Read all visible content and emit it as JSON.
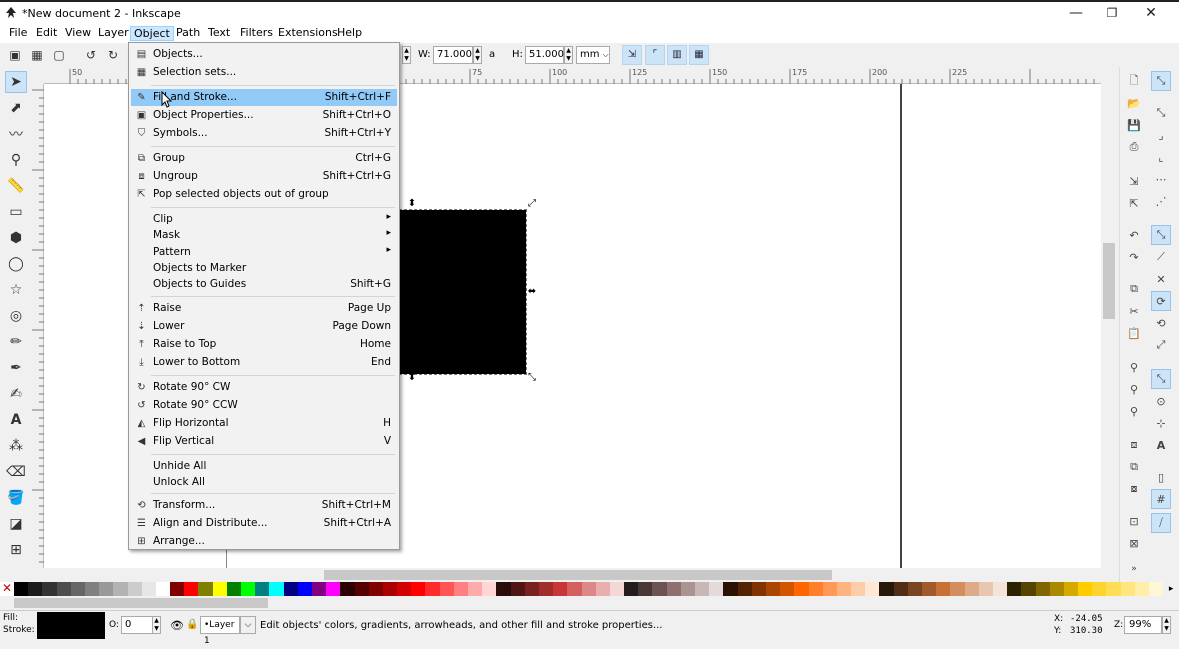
{
  "window": {
    "title": "*New document 2 - Inkscape",
    "minimize": "—",
    "maximize": "❐",
    "close": "✕"
  },
  "menubar": [
    "File",
    "Edit",
    "View",
    "Layer",
    "Object",
    "Path",
    "Text",
    "Filters",
    "Extensions",
    "Help"
  ],
  "toolbar": {
    "w_label": "W:",
    "w_value": "71.000",
    "h_label": "H:",
    "h_value": "51.000",
    "unit": "mm",
    "lock_symbol": "a"
  },
  "ruler": {
    "h_ticks": [
      "50",
      "75",
      "100",
      "125",
      "150",
      "175",
      "200",
      "225"
    ],
    "v_ticks": [
      "0",
      "25",
      "50",
      "75",
      "100",
      "125",
      "150"
    ]
  },
  "object_menu": {
    "groups": [
      [
        {
          "icon": "objects-icon",
          "glyph": "▤",
          "label": "Objects...",
          "shortcut": ""
        },
        {
          "icon": "selection-sets-icon",
          "glyph": "▦",
          "label": "Selection sets...",
          "shortcut": ""
        }
      ],
      [
        {
          "icon": "fill-stroke-icon",
          "glyph": "✎",
          "label": "Fill and Stroke...",
          "shortcut": "Shift+Ctrl+F",
          "highlight": true
        },
        {
          "icon": "object-properties-icon",
          "glyph": "▣",
          "label": "Object Properties...",
          "shortcut": "Shift+Ctrl+O"
        },
        {
          "icon": "symbols-icon",
          "glyph": "⛉",
          "label": "Symbols...",
          "shortcut": "Shift+Ctrl+Y"
        }
      ],
      [
        {
          "icon": "group-icon",
          "glyph": "⧉",
          "label": "Group",
          "shortcut": "Ctrl+G"
        },
        {
          "icon": "ungroup-icon",
          "glyph": "⧈",
          "label": "Ungroup",
          "shortcut": "Shift+Ctrl+G"
        },
        {
          "icon": "pop-out-icon",
          "glyph": "⇱",
          "label": "Pop selected objects out of group",
          "shortcut": ""
        }
      ],
      [
        {
          "icon": "",
          "glyph": "",
          "label": "Clip",
          "shortcut": "",
          "submenu": true
        },
        {
          "icon": "",
          "glyph": "",
          "label": "Mask",
          "shortcut": "",
          "submenu": true
        },
        {
          "icon": "",
          "glyph": "",
          "label": "Pattern",
          "shortcut": "",
          "submenu": true
        },
        {
          "icon": "",
          "glyph": "",
          "label": "Objects to Marker",
          "shortcut": ""
        },
        {
          "icon": "",
          "glyph": "",
          "label": "Objects to Guides",
          "shortcut": "Shift+G"
        }
      ],
      [
        {
          "icon": "raise-icon",
          "glyph": "⇡",
          "label": "Raise",
          "shortcut": "Page Up"
        },
        {
          "icon": "lower-icon",
          "glyph": "⇣",
          "label": "Lower",
          "shortcut": "Page Down"
        },
        {
          "icon": "raise-to-top-icon",
          "glyph": "⤒",
          "label": "Raise to Top",
          "shortcut": "Home"
        },
        {
          "icon": "lower-to-bottom-icon",
          "glyph": "⤓",
          "label": "Lower to Bottom",
          "shortcut": "End"
        }
      ],
      [
        {
          "icon": "rotate-cw-icon",
          "glyph": "↻",
          "label": "Rotate 90° CW",
          "shortcut": ""
        },
        {
          "icon": "rotate-ccw-icon",
          "glyph": "↺",
          "label": "Rotate 90° CCW",
          "shortcut": ""
        },
        {
          "icon": "flip-horizontal-icon",
          "glyph": "◭",
          "label": "Flip Horizontal",
          "shortcut": "H"
        },
        {
          "icon": "flip-vertical-icon",
          "glyph": "◀",
          "label": "Flip Vertical",
          "shortcut": "V"
        }
      ],
      [
        {
          "icon": "",
          "glyph": "",
          "label": "Unhide All",
          "shortcut": ""
        },
        {
          "icon": "",
          "glyph": "",
          "label": "Unlock All",
          "shortcut": ""
        }
      ],
      [
        {
          "icon": "transform-icon",
          "glyph": "⟲",
          "label": "Transform...",
          "shortcut": "Shift+Ctrl+M"
        },
        {
          "icon": "align-distribute-icon",
          "glyph": "☰",
          "label": "Align and Distribute...",
          "shortcut": "Shift+Ctrl+A"
        },
        {
          "icon": "arrange-icon",
          "glyph": "⊞",
          "label": "Arrange...",
          "shortcut": ""
        }
      ]
    ]
  },
  "status": {
    "fill_label": "Fill:",
    "stroke_label": "Stroke:",
    "stroke_width": "1",
    "opacity_label": "O:",
    "opacity_value": "0",
    "layer": "•Layer 1",
    "message": "Edit objects' colors, gradients, arrowheads, and other fill and stroke properties...",
    "x_label": "X:",
    "x_value": "-24.05",
    "y_label": "Y:",
    "y_value": "310.30",
    "zoom_label": "Z:",
    "zoom_value": "99%"
  },
  "palette": [
    "#000000",
    "#1a1a1a",
    "#333333",
    "#4d4d4d",
    "#666666",
    "#808080",
    "#999999",
    "#b3b3b3",
    "#cccccc",
    "#e6e6e6",
    "#ffffff",
    "#800000",
    "#ff0000",
    "#808000",
    "#ffff00",
    "#008000",
    "#00ff00",
    "#008080",
    "#00ffff",
    "#000080",
    "#0000ff",
    "#800080",
    "#ff00ff",
    "#2b0000",
    "#550000",
    "#800000",
    "#aa0000",
    "#d40000",
    "#ff0000",
    "#ff2a2a",
    "#ff5555",
    "#ff8080",
    "#ffaaaa",
    "#ffd5d5",
    "#280b0b",
    "#501616",
    "#782121",
    "#a02c2c",
    "#c83737",
    "#d35f5f",
    "#de8787",
    "#e9afaf",
    "#f4d7d7",
    "#241c1c",
    "#483737",
    "#6c5353",
    "#916f6f",
    "#ac9393",
    "#c8b7b7",
    "#e3dbdb",
    "#2b1100",
    "#552200",
    "#803300",
    "#aa4400",
    "#d45500",
    "#ff6600",
    "#ff7f2a",
    "#ff9955",
    "#ffb380",
    "#ffccaa",
    "#ffe6d5",
    "#28170b",
    "#502d16",
    "#784421",
    "#a05a2c",
    "#c87137",
    "#d38d5f",
    "#deaa87",
    "#e9c6af",
    "#f4e3d7",
    "#2b2200",
    "#554400",
    "#806600",
    "#aa8800",
    "#d4aa00",
    "#ffcc00",
    "#ffd42a",
    "#ffdd55",
    "#ffe680",
    "#ffeeaa",
    "#fff6d5"
  ]
}
